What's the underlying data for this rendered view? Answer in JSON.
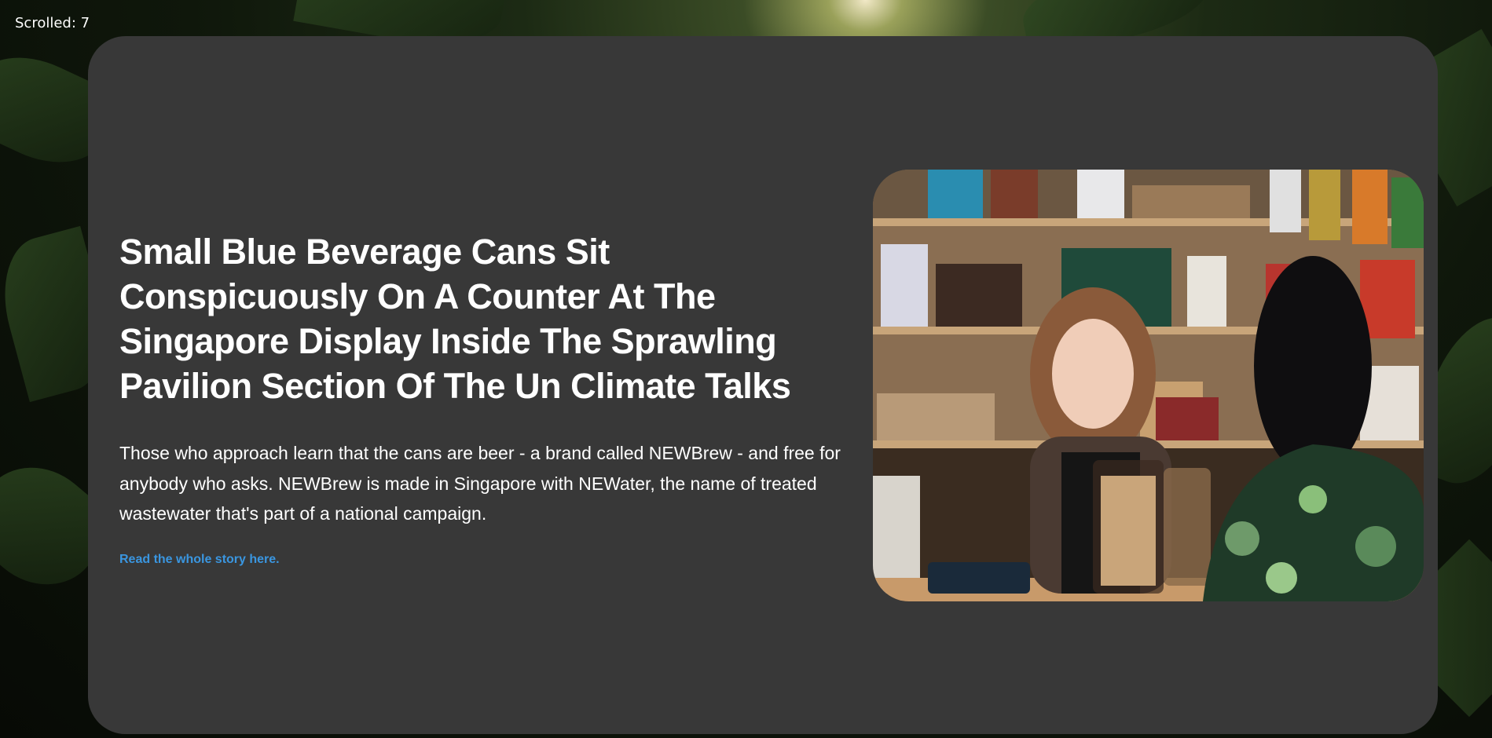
{
  "scroll_indicator": "Scrolled: 7",
  "article": {
    "headline": "Small Blue Beverage Cans Sit Conspicuously On A Counter At The Singapore Display Inside The Sprawling Pavilion Section Of The Un Climate Talks",
    "body": "Those who approach learn that the cans are beer - a brand called NEWBrew - and free for anybody who asks. NEWBrew is made in Singapore with NEWater, the name of treated wastewater that's part of a national campaign.",
    "link_label": "Read the whole story here."
  },
  "colors": {
    "card_background": "#383838",
    "link": "#3a96e0",
    "text": "#ffffff"
  },
  "images": {
    "background": "jungle-foliage-photo",
    "story_photo": "shop-counter-photo"
  }
}
